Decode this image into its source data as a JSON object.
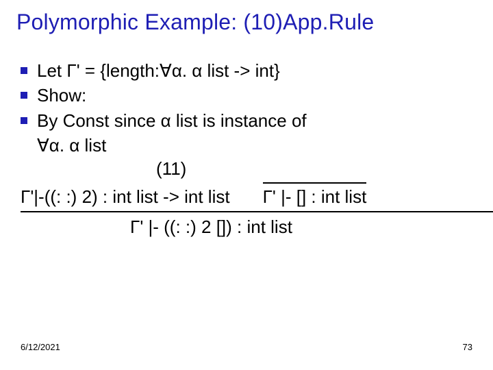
{
  "title": "Polymorphic Example: (10)App.Rule",
  "bullets": {
    "let": "Let Γ' = {length:∀α. α list -> int}",
    "show": "Show:",
    "const": "By Const since α list  is instance of"
  },
  "lines": {
    "forall_list": "∀α. α list",
    "eleven": "(11)",
    "premise_left": "Γ'|-((: :) 2) : int list -> int list",
    "premise_right": "Γ' |- [] : int list",
    "conclusion": "Γ' |- ((: :) 2 []) : int list"
  },
  "footer": {
    "date": "6/12/2021",
    "page": "73"
  }
}
